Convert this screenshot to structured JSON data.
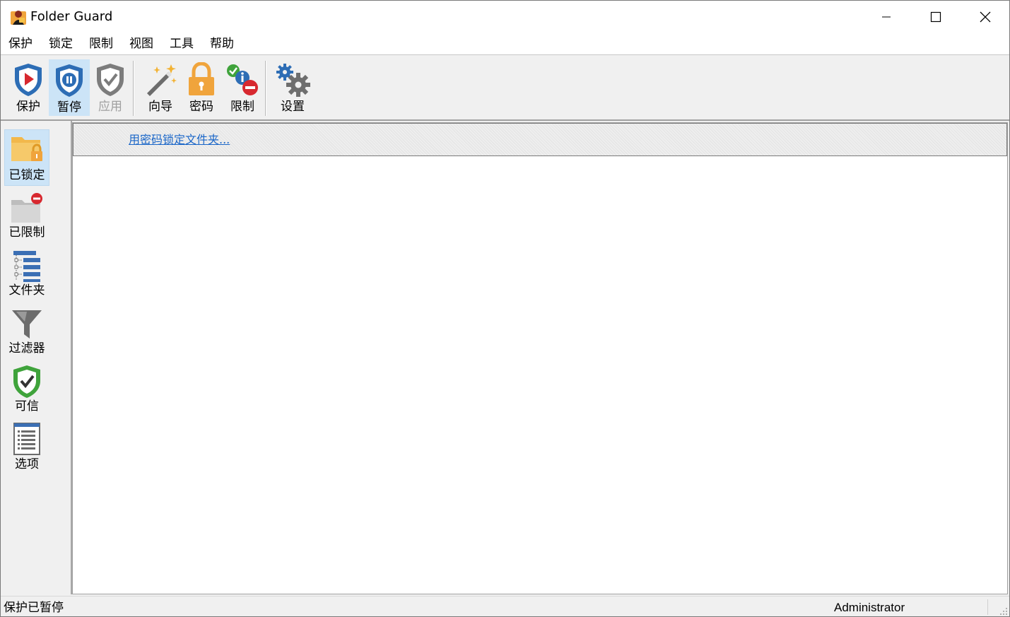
{
  "window": {
    "title": "Folder Guard"
  },
  "menu": [
    "保护",
    "锁定",
    "限制",
    "视图",
    "工具",
    "帮助"
  ],
  "toolbar": {
    "protect": "保护",
    "pause": "暂停",
    "apply": "应用",
    "wizard": "向导",
    "password": "密码",
    "restrict": "限制",
    "settings": "设置"
  },
  "sidebar": {
    "locked": "已锁定",
    "restricted": "已限制",
    "folders": "文件夹",
    "filters": "过滤器",
    "trusted": "可信",
    "options": "选项"
  },
  "content": {
    "link": "用密码锁定文件夹..."
  },
  "status": {
    "left": "保护已暂停",
    "right": "Administrator"
  },
  "colors": {
    "accent": "#1a66c8",
    "selected": "#cce4f7",
    "shield_blue": "#2d6db5",
    "lock_orange": "#f0a43c"
  }
}
